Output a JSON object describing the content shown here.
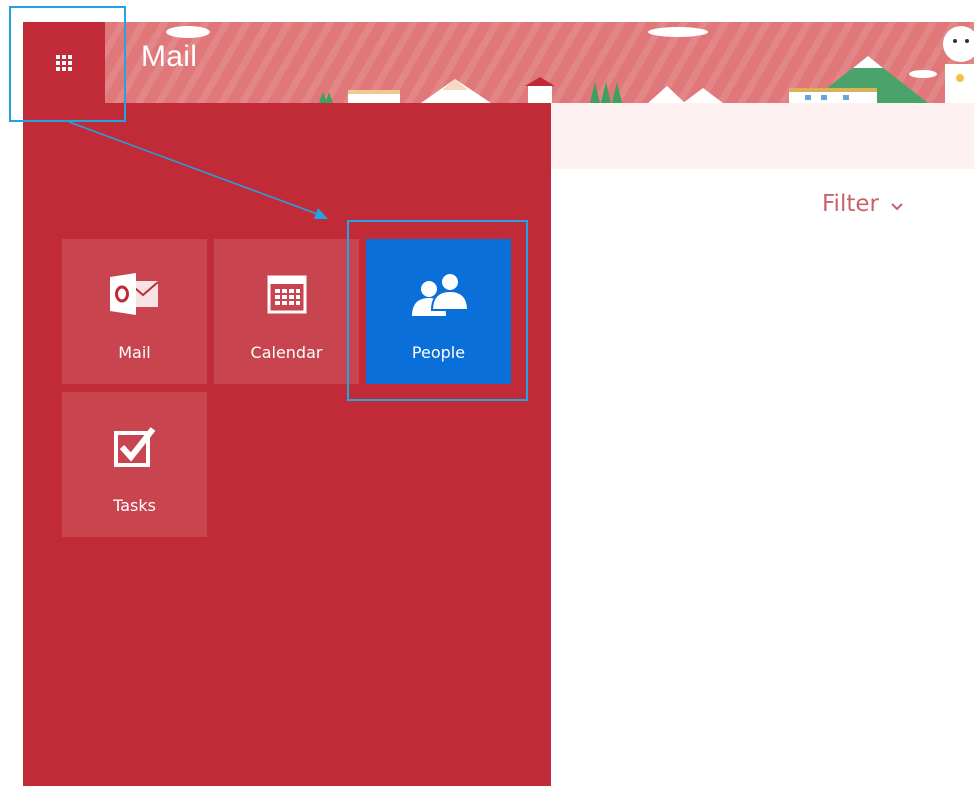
{
  "header": {
    "app_title": "Mail",
    "waffle_icon": "waffle-grid-icon"
  },
  "colors": {
    "launcher_bg": "#c12b37",
    "banner_bg": "#e0787a",
    "active_tile": "#0a6fd8",
    "filter_text": "#c9636a",
    "annotation": "#21a3e6"
  },
  "launcher": {
    "tiles": [
      {
        "label": "Mail",
        "icon": "outlook-mail-icon",
        "active": false
      },
      {
        "label": "Calendar",
        "icon": "calendar-icon",
        "active": false
      },
      {
        "label": "People",
        "icon": "people-icon",
        "active": true
      },
      {
        "label": "Tasks",
        "icon": "tasks-checkbox-icon",
        "active": false
      }
    ]
  },
  "toolbar": {
    "filter_label": "Filter",
    "filter_icon": "chevron-down-icon"
  }
}
